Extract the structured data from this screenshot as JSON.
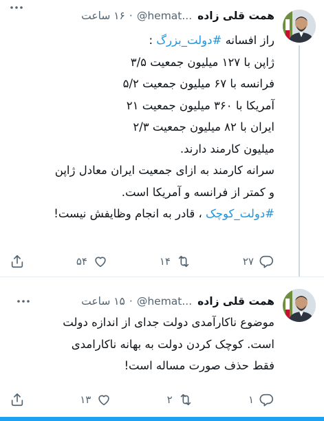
{
  "tweets": [
    {
      "author_name": "همت قلی زاده",
      "handle": "@hemat...",
      "separator": "·",
      "time": "۱۶ ساعت",
      "lines": [
        {
          "parts": [
            {
              "text": "راز افسانه "
            },
            {
              "text": "#دولت_بزرگ",
              "hashtag": true
            },
            {
              "text": " :"
            }
          ]
        },
        {
          "parts": [
            {
              "text": "ژاپن با ۱۲۷ میلیون جمعیت ۳/۵"
            }
          ]
        },
        {
          "parts": [
            {
              "text": "فرانسه با ۶۷ میلیون جمعیت ۵/۲"
            }
          ]
        },
        {
          "parts": [
            {
              "text": "آمریکا با ۳۶۰ میلیون جمعیت ۲۱"
            }
          ]
        },
        {
          "parts": [
            {
              "text": "ایران با ۸۲ میلیون جمعیت ۲/۳"
            }
          ]
        },
        {
          "parts": [
            {
              "text": "میلیون کارمند دارند."
            }
          ]
        },
        {
          "parts": [
            {
              "text": "سرانه کارمند به ازای جمعیت ایران معادل ژاپن"
            }
          ]
        },
        {
          "parts": [
            {
              "text": "و کمتر از فرانسه و آمریکا است."
            }
          ]
        },
        {
          "parts": [
            {
              "text": "#دولت_کوچک",
              "hashtag": true
            },
            {
              "text": " ، قادر به انجام وظایفش نیست!"
            }
          ]
        }
      ],
      "actions": {
        "reply": "۲۷",
        "retweet": "۱۴",
        "like": "۵۴"
      }
    },
    {
      "author_name": "همت قلی زاده",
      "handle": "@hemat...",
      "separator": "·",
      "time": "۱۵ ساعت",
      "lines": [
        {
          "parts": [
            {
              "text": "موضوع ناکارآمدی دولت جدای از اندازه دولت"
            }
          ]
        },
        {
          "parts": [
            {
              "text": "است. کوچک کردن دولت به بهانه ناکارامدی"
            }
          ]
        },
        {
          "parts": [
            {
              "text": "فقط حذف صورت مساله است!"
            }
          ]
        }
      ],
      "actions": {
        "reply": "۱",
        "retweet": "۲",
        "like": "۱۳"
      }
    }
  ],
  "icons": {
    "reply": "reply-icon",
    "retweet": "retweet-icon",
    "like": "heart-icon",
    "share": "share-icon",
    "more": "more-icon",
    "avatar": "avatar-image"
  },
  "colors": {
    "hashtag": "#1b95e0",
    "secondary_text": "#536471",
    "accent_bar": "#1da1f2",
    "thread_line": "#cfd9de"
  }
}
